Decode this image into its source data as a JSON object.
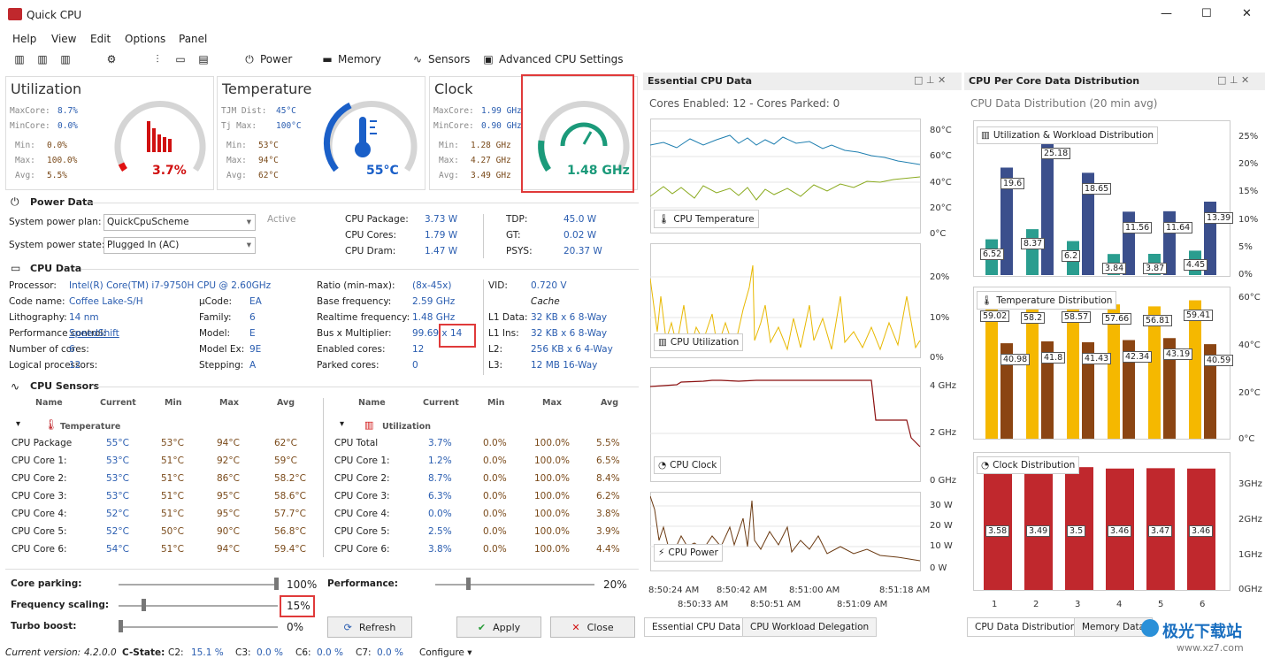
{
  "window": {
    "title": "Quick CPU",
    "minimize": "—",
    "maximize": "☐",
    "close": "✕"
  },
  "menu": [
    "Help",
    "View",
    "Edit",
    "Options",
    "Panel"
  ],
  "toolbar": {
    "power": "Power",
    "memory": "Memory",
    "sensors": "Sensors",
    "advanced": "Advanced CPU Settings"
  },
  "utilization": {
    "title": "Utilization",
    "maxcore_label": "MaxCore:",
    "maxcore": "8.7%",
    "mincore_label": "MinCore:",
    "mincore": "0.0%",
    "min_label": "Min:",
    "min": "0.0%",
    "max_label": "Max:",
    "max": "100.0%",
    "avg_label": "Avg:",
    "avg": "5.5%",
    "gauge": "3.7%",
    "gauge_value": 3.7
  },
  "temperature": {
    "title": "Temperature",
    "tjm_label": "TJM Dist:",
    "tjm": "45°C",
    "tjmax_label": "Tj Max:",
    "tjmax": "100°C",
    "min_label": "Min:",
    "min": "53°C",
    "max_label": "Max:",
    "max": "94°C",
    "avg_label": "Avg:",
    "avg": "62°C",
    "gauge": "55°C",
    "gauge_value": 55
  },
  "clock": {
    "title": "Clock",
    "maxcore_label": "MaxCore:",
    "maxcore": "1.99 GHz",
    "mincore_label": "MinCore:",
    "mincore": "0.90 GHz",
    "min_label": "Min:",
    "min": "1.28 GHz",
    "max_label": "Max:",
    "max": "4.27 GHz",
    "avg_label": "Avg:",
    "avg": "3.49 GHz",
    "gauge": "1.48 GHz",
    "gauge_value": 1.48
  },
  "power_data": {
    "title": "Power Data",
    "plan_label": "System power plan:",
    "plan": "QuickCpuScheme",
    "active": "Active",
    "state_label": "System power state:",
    "state": "Plugged In (AC)",
    "rows": [
      {
        "l": "CPU Package:",
        "v": "3.73 W",
        "l2": "TDP:",
        "v2": "45.0 W"
      },
      {
        "l": "CPU Cores:",
        "v": "1.79 W",
        "l2": "GT:",
        "v2": "0.02 W"
      },
      {
        "l": "CPU Dram:",
        "v": "1.47 W",
        "l2": "PSYS:",
        "v2": "20.37 W"
      }
    ]
  },
  "cpu_data": {
    "title": "CPU Data",
    "c1": [
      {
        "l": "Processor:",
        "v": "Intel(R) Core(TM) i7-9750H CPU @ 2.60GHz"
      },
      {
        "l": "Code name:",
        "v": "Coffee Lake-S/H"
      },
      {
        "l": "Lithography:",
        "v": "14 nm"
      },
      {
        "l": "Performance control:",
        "v": "SpeedShift"
      },
      {
        "l": "Number of cores:",
        "v": "6"
      },
      {
        "l": "Logical processors:",
        "v": "12"
      }
    ],
    "c2": [
      {
        "l": "",
        "v": ""
      },
      {
        "l": "µCode:",
        "v": "EA"
      },
      {
        "l": "Family:",
        "v": "6"
      },
      {
        "l": "Model:",
        "v": "E"
      },
      {
        "l": "Model Ex:",
        "v": "9E"
      },
      {
        "l": "Stepping:",
        "v": "A"
      }
    ],
    "c3": [
      {
        "l": "Ratio (min-max):",
        "v": "(8x-45x)"
      },
      {
        "l": "Base frequency:",
        "v": "2.59 GHz"
      },
      {
        "l": "Realtime frequency:",
        "v": "1.48 GHz"
      },
      {
        "l": "Bus x Multiplier:",
        "v": "99.69 x 14"
      },
      {
        "l": "Enabled cores:",
        "v": "12"
      },
      {
        "l": "Parked cores:",
        "v": "0"
      }
    ],
    "c4": [
      {
        "l": "VID:",
        "v": "0.720 V"
      },
      {
        "l": "",
        "v": "Cache"
      },
      {
        "l": "L1 Data:",
        "v": "32 KB x 6  8-Way"
      },
      {
        "l": "L1 Ins:",
        "v": "32 KB x 6  8-Way"
      },
      {
        "l": "L2:",
        "v": "256 KB x 6  4-Way"
      },
      {
        "l": "L3:",
        "v": "12 MB  16-Way"
      }
    ]
  },
  "sensors": {
    "title": "CPU Sensors",
    "headers": [
      "Name",
      "Current",
      "Min",
      "Max",
      "Avg"
    ],
    "temp_group": "Temperature",
    "util_group": "Utilization",
    "temp_rows": [
      [
        "CPU Package",
        "55°C",
        "53°C",
        "94°C",
        "62°C"
      ],
      [
        "CPU Core 1:",
        "53°C",
        "51°C",
        "92°C",
        "59°C"
      ],
      [
        "CPU Core 2:",
        "53°C",
        "51°C",
        "86°C",
        "58.2°C"
      ],
      [
        "CPU Core 3:",
        "53°C",
        "51°C",
        "95°C",
        "58.6°C"
      ],
      [
        "CPU Core 4:",
        "52°C",
        "51°C",
        "95°C",
        "57.7°C"
      ],
      [
        "CPU Core 5:",
        "52°C",
        "50°C",
        "90°C",
        "56.8°C"
      ],
      [
        "CPU Core 6:",
        "54°C",
        "51°C",
        "94°C",
        "59.4°C"
      ]
    ],
    "util_rows": [
      [
        "CPU Total",
        "3.7%",
        "0.0%",
        "100.0%",
        "5.5%"
      ],
      [
        "CPU Core 1:",
        "1.2%",
        "0.0%",
        "100.0%",
        "6.5%"
      ],
      [
        "CPU Core 2:",
        "8.7%",
        "0.0%",
        "100.0%",
        "8.4%"
      ],
      [
        "CPU Core 3:",
        "6.3%",
        "0.0%",
        "100.0%",
        "6.2%"
      ],
      [
        "CPU Core 4:",
        "0.0%",
        "0.0%",
        "100.0%",
        "3.8%"
      ],
      [
        "CPU Core 5:",
        "2.5%",
        "0.0%",
        "100.0%",
        "3.9%"
      ],
      [
        "CPU Core 6:",
        "3.8%",
        "0.0%",
        "100.0%",
        "4.4%"
      ]
    ]
  },
  "controls": {
    "core_parking": "Core parking:",
    "core_parking_val": "100%",
    "core_parking_level": 100,
    "freq_scaling": "Frequency scaling:",
    "freq_scaling_val": "15%",
    "freq_scaling_level": 15,
    "turbo": "Turbo boost:",
    "turbo_val": "0%",
    "turbo_level": 0,
    "performance": "Performance:",
    "performance_val": "20%",
    "performance_level": 20,
    "refresh": "Refresh",
    "apply": "Apply",
    "close": "Close"
  },
  "essential": {
    "title": "Essential CPU Data",
    "summary": "Cores Enabled: 12 - Cores Parked: 0",
    "temp_label": "CPU Temperature",
    "temp_ticks": [
      "80°C",
      "60°C",
      "40°C",
      "20°C",
      "0°C"
    ],
    "util_label": "CPU Utilization",
    "util_ticks": [
      "20%",
      "10%",
      "0%"
    ],
    "clock_label": "CPU Clock",
    "clock_ticks": [
      "4 GHz",
      "2 GHz",
      "0 GHz"
    ],
    "power_label": "CPU Power",
    "power_ticks": [
      "30 W",
      "20 W",
      "10 W",
      "0 W"
    ],
    "times_top": [
      "8:50:24 AM",
      "8:50:42 AM",
      "8:51:00 AM",
      "8:51:18 AM"
    ],
    "times_bottom": [
      "8:50:33 AM",
      "8:50:51 AM",
      "8:51:09 AM"
    ]
  },
  "distribution": {
    "title": "CPU Per Core Data Distribution",
    "subtitle": "CPU Data Distribution (20 min avg)",
    "util_label": "Utilization & Workload Distribution",
    "util_ticks": [
      "25%",
      "20%",
      "15%",
      "10%",
      "5%",
      "0%"
    ],
    "temp_label": "Temperature Distribution",
    "temp_ticks": [
      "60°C",
      "40°C",
      "20°C",
      "0°C"
    ],
    "clock_label": "Clock Distribution",
    "clock_ticks": [
      "3GHz",
      "2GHz",
      "1GHz",
      "0GHz"
    ],
    "cores": [
      "1",
      "2",
      "3",
      "4",
      "5",
      "6"
    ]
  },
  "chart_data": [
    {
      "type": "bar",
      "title": "Utilization & Workload Distribution",
      "categories": [
        "1",
        "2",
        "3",
        "4",
        "5",
        "6"
      ],
      "series": [
        {
          "values": [
            6.52,
            8.37,
            6.2,
            3.84,
            3.87,
            4.45
          ]
        },
        {
          "values": [
            19.6,
            25.18,
            18.65,
            11.56,
            11.64,
            13.39
          ]
        }
      ],
      "ylim": [
        0,
        25
      ]
    },
    {
      "type": "bar",
      "title": "Temperature Distribution",
      "categories": [
        "1",
        "2",
        "3",
        "4",
        "5",
        "6"
      ],
      "series": [
        {
          "values": [
            59.02,
            58.2,
            58.57,
            57.66,
            56.81,
            59.41
          ]
        },
        {
          "values": [
            40.98,
            41.8,
            41.43,
            42.34,
            43.19,
            40.59
          ]
        }
      ],
      "ylim": [
        0,
        60
      ]
    },
    {
      "type": "bar",
      "title": "Clock Distribution",
      "categories": [
        "1",
        "2",
        "3",
        "4",
        "5",
        "6"
      ],
      "series": [
        {
          "values": [
            3.58,
            3.49,
            3.5,
            3.46,
            3.47,
            3.46
          ]
        }
      ],
      "ylim": [
        0,
        3.5
      ]
    }
  ],
  "tabs": {
    "essential": "Essential CPU Data",
    "workload": "CPU Workload Delegation",
    "dist": "CPU Data Distribution",
    "memory": "Memory Data"
  },
  "status": {
    "version_label": "Current version:",
    "version": "4.2.0.0",
    "cstate": "C-State:",
    "c2l": "C2:",
    "c2": "15.1 %",
    "c3l": "C3:",
    "c3": "0.0 %",
    "c6l": "C6:",
    "c6": "0.0 %",
    "c7l": "C7:",
    "c7": "0.0 %",
    "configure": "Configure ▾"
  },
  "watermark": {
    "text": "极光下载站",
    "url": "www.xz7.com"
  },
  "colors": {
    "teal": "#2a9d8f",
    "navy": "#3b4f8c",
    "orange": "#f5b800",
    "brown": "#8b4513",
    "red": "#c0282d",
    "accent": "#2a5db0"
  }
}
